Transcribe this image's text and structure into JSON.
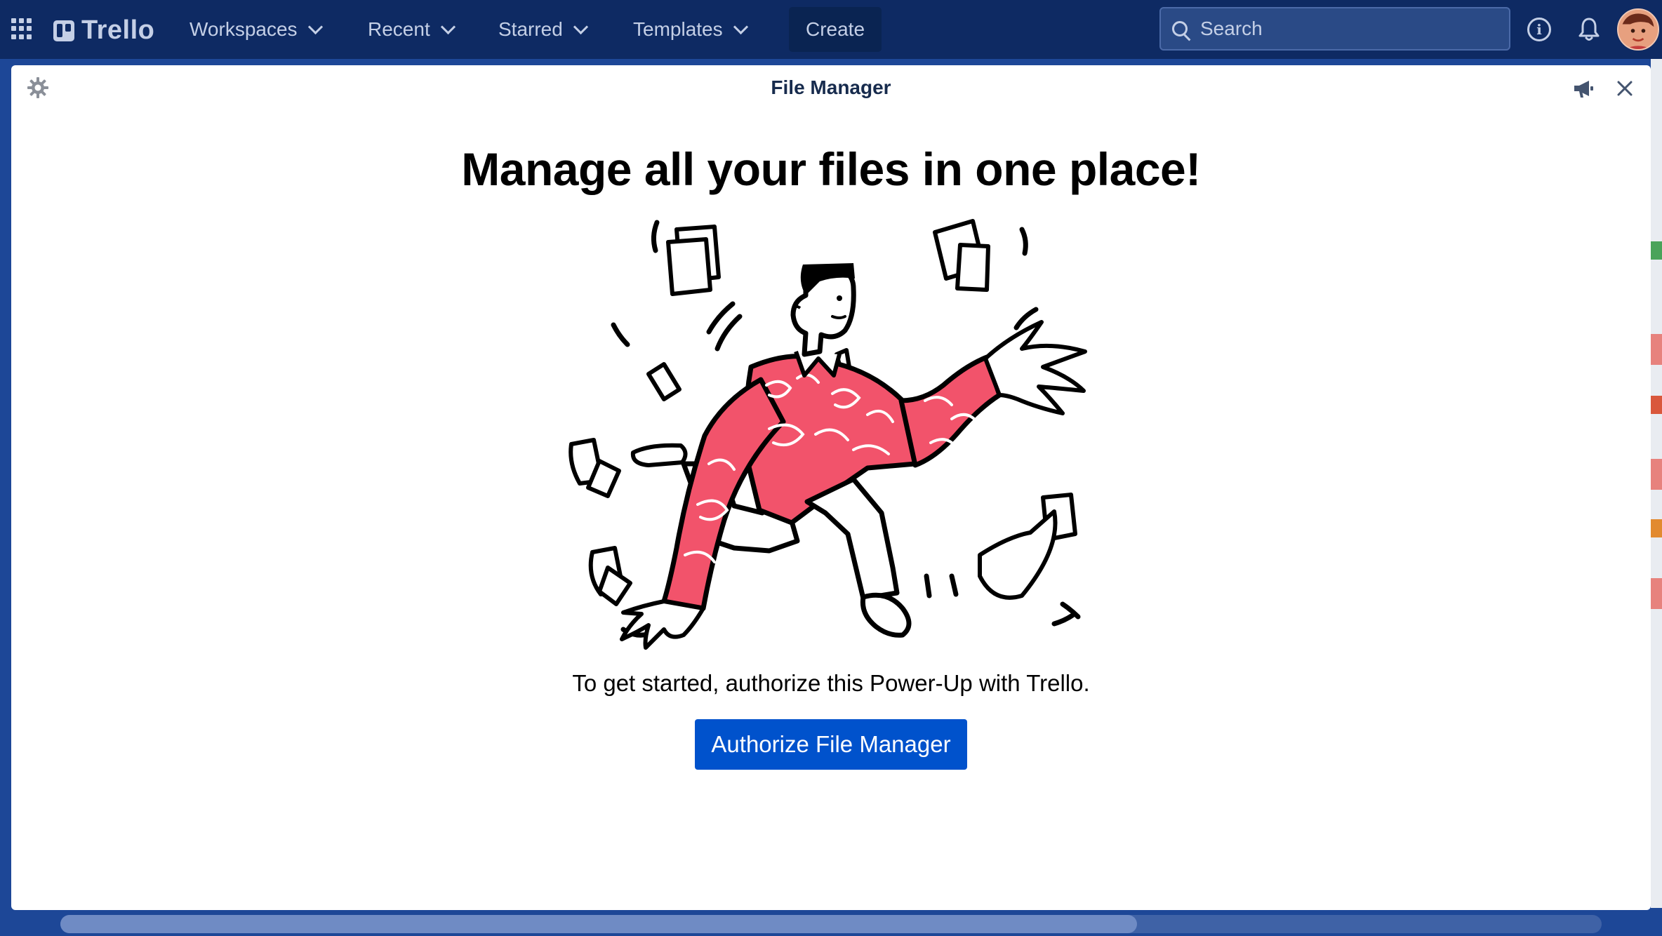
{
  "topbar": {
    "logo_text": "Trello",
    "nav": {
      "workspaces": "Workspaces",
      "recent": "Recent",
      "starred": "Starred",
      "templates": "Templates"
    },
    "create_label": "Create",
    "search_placeholder": "Search",
    "info_glyph": "i"
  },
  "modal": {
    "title": "File Manager",
    "headline": "Manage all your files in one place!",
    "subtext": "To get started, authorize this Power-Up with Trello.",
    "authorize_label": "Authorize File Manager"
  },
  "colors": {
    "nav_bg": "#0e2a63",
    "board_bg": "#1d4797",
    "primary_button": "#0052cc",
    "illustration_accent": "#f2536b"
  },
  "icons": [
    "apps-grid-icon",
    "trello-logo-icon",
    "chevron-down-icon",
    "search-icon",
    "info-icon",
    "bell-icon",
    "gear-icon",
    "megaphone-icon",
    "close-icon"
  ]
}
